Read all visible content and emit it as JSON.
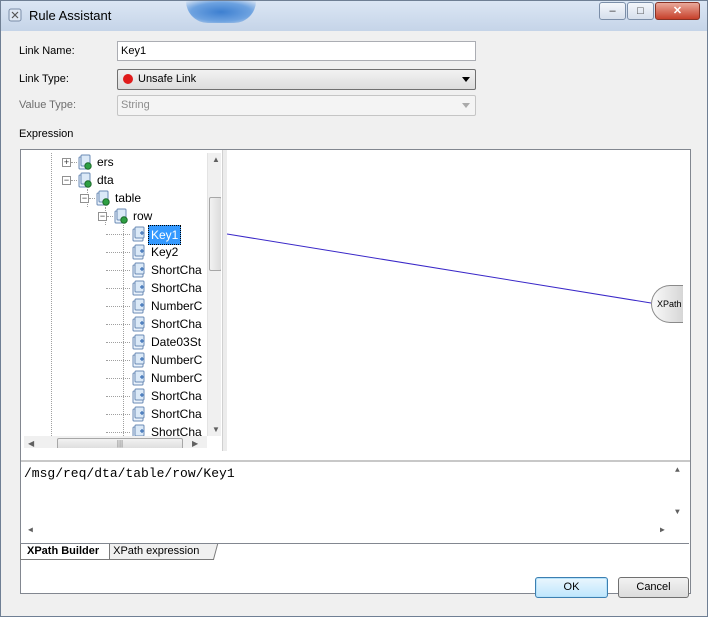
{
  "window": {
    "title": "Rule Assistant",
    "controls": {
      "minimize": "‒",
      "maximize": "□",
      "close": "✕"
    }
  },
  "form": {
    "link_name": {
      "label": "Link Name:",
      "value": "Key1"
    },
    "link_type": {
      "label": "Link Type:",
      "value": "Unsafe Link",
      "status_color": "#e01b1b"
    },
    "value_type": {
      "label": "Value Type:",
      "value": "String",
      "disabled": true
    },
    "expression_label": "Expression"
  },
  "tree": {
    "nodes": [
      {
        "label": "ers",
        "toggle": "+"
      },
      {
        "label": "dta",
        "toggle": "−"
      },
      {
        "label": "table",
        "toggle": "−"
      },
      {
        "label": "row",
        "toggle": "−"
      },
      {
        "label": "Key1",
        "selected": true
      },
      {
        "label": "Key2"
      },
      {
        "label": "ShortCha"
      },
      {
        "label": "ShortCha"
      },
      {
        "label": "NumberC"
      },
      {
        "label": "ShortCha"
      },
      {
        "label": "Date03St"
      },
      {
        "label": "NumberC"
      },
      {
        "label": "NumberC"
      },
      {
        "label": "ShortCha"
      },
      {
        "label": "ShortCha"
      },
      {
        "label": "ShortCha"
      }
    ]
  },
  "canvas": {
    "target_node": "XPath"
  },
  "expression": {
    "text": "/msg/req/dta/table/row/Key1"
  },
  "tabs": [
    {
      "label": "XPath Builder",
      "active": true
    },
    {
      "label": "XPath expression",
      "active": false
    }
  ],
  "buttons": {
    "ok": "OK",
    "cancel": "Cancel"
  }
}
